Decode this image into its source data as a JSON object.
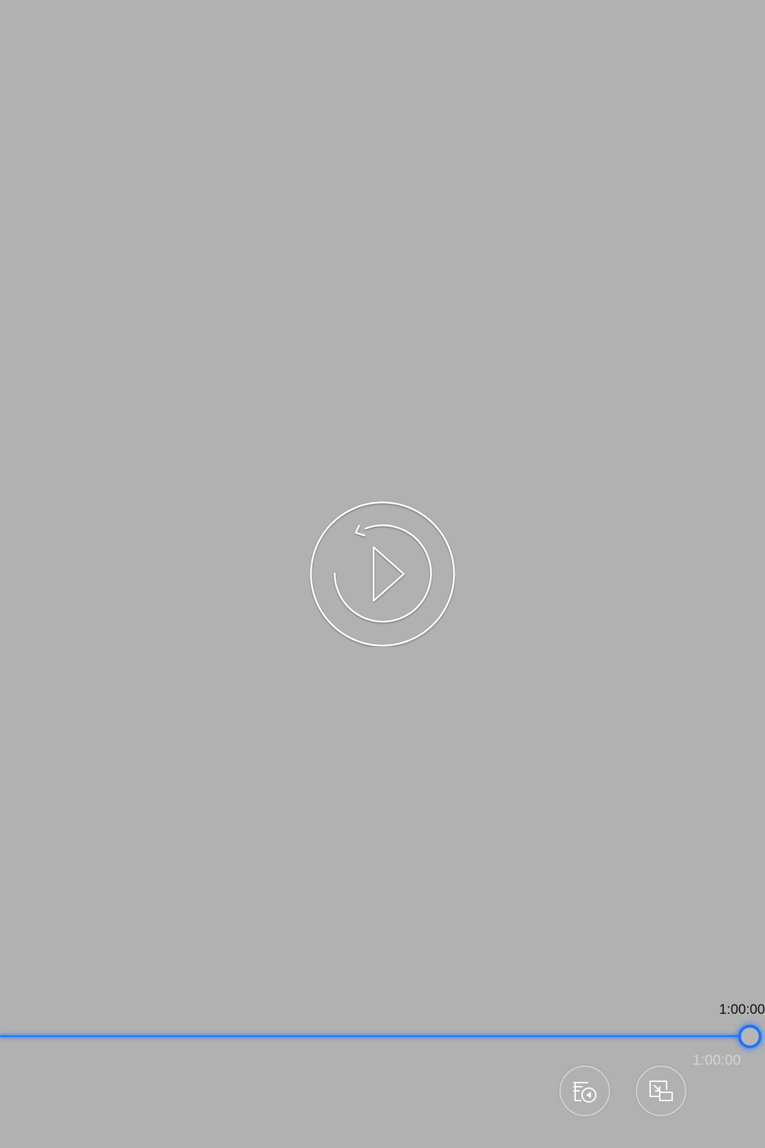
{
  "player": {
    "state": "ended",
    "current_time_label": "1:00:00",
    "duration_label": "1:00:00",
    "progress_fraction": 1.0
  },
  "icons": {
    "center": "replay-icon",
    "left_control": "playlist-play-icon",
    "right_control": "picture-in-picture-icon"
  },
  "colors": {
    "background": "#b1b1b1",
    "accent": "#1b73ff",
    "icon_stroke": "#ffffff"
  }
}
